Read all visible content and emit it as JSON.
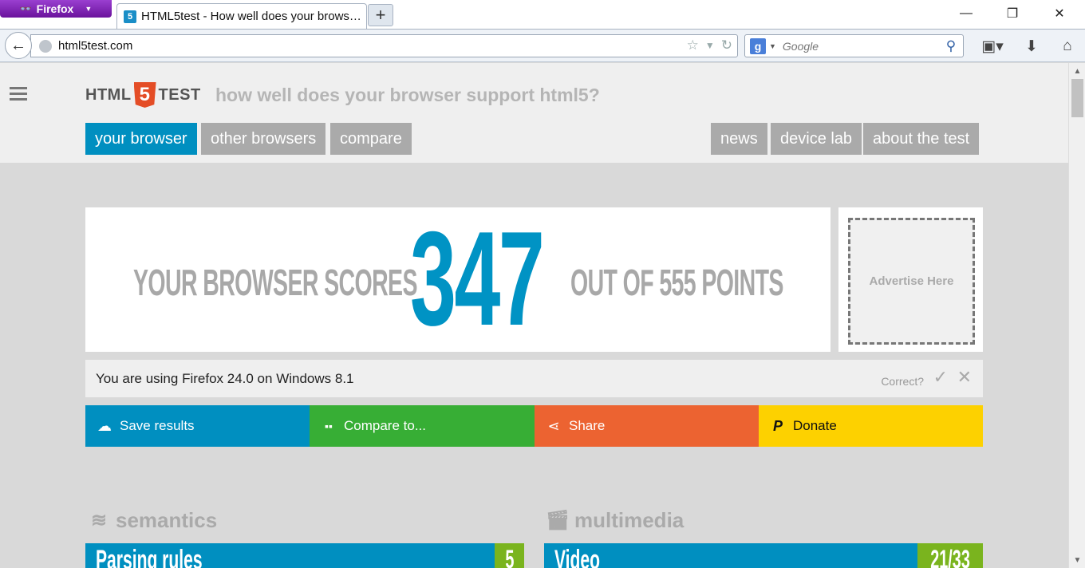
{
  "browser": {
    "menu_label": "Firefox",
    "tab_title": "HTML5test - How well does your browser support HTML5?",
    "new_tab_label": "+",
    "url": "html5test.com",
    "search_placeholder": "Google",
    "window_controls": {
      "minimize": "—",
      "restore": "❐",
      "close": "✕"
    }
  },
  "site": {
    "logo_left": "HTML",
    "logo_shield": "5",
    "logo_right": "TEST",
    "tagline": "how well does your browser support html5?",
    "nav_left": [
      {
        "label": "your browser"
      },
      {
        "label": "other browsers"
      },
      {
        "label": "compare"
      }
    ],
    "nav_right": [
      {
        "label": "news"
      },
      {
        "label": "device lab"
      },
      {
        "label": "about the test"
      }
    ]
  },
  "score": {
    "prefix": "YOUR BROWSER SCORES",
    "value": "347",
    "suffix": "OUT OF 555 POINTS"
  },
  "ad": {
    "label": "Advertise Here"
  },
  "user_agent": {
    "text": "You are using Firefox 24.0 on Windows 8.1",
    "correct_label": "Correct?"
  },
  "actions": [
    {
      "label": "Save results",
      "icon": "cloud-upload-icon",
      "color": "#008fc0"
    },
    {
      "label": "Compare to...",
      "icon": "grid-icon",
      "color": "#37ae35"
    },
    {
      "label": "Share",
      "icon": "share-icon",
      "color": "#ec6331"
    },
    {
      "label": "Donate",
      "icon": "paypal-icon",
      "color": "#fdd100"
    }
  ],
  "sections": [
    {
      "title": "semantics",
      "category": "Parsing rules",
      "score": "5"
    },
    {
      "title": "multimedia",
      "category": "Video",
      "score": "21/33"
    }
  ]
}
